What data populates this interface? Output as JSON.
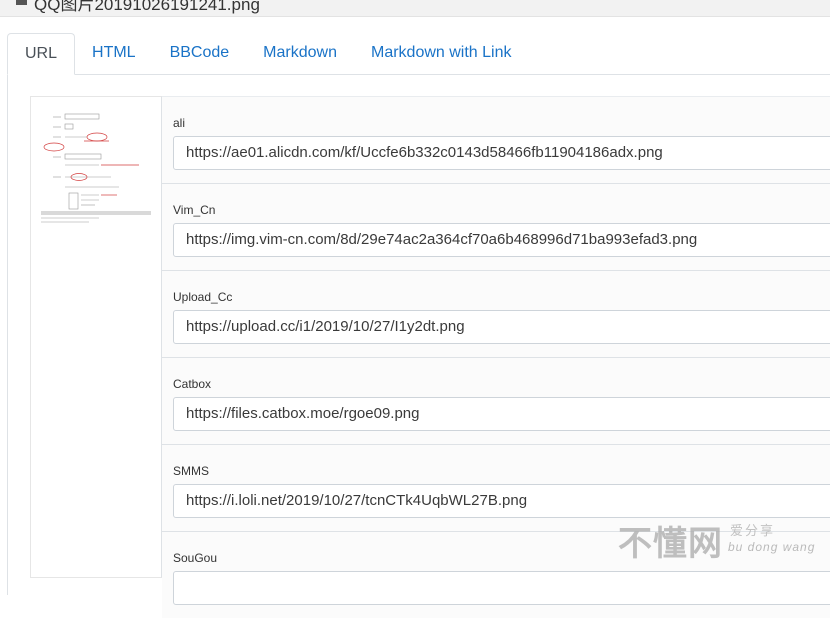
{
  "window": {
    "title": "QQ图片20191026191241.png"
  },
  "tabs": [
    {
      "label": "URL",
      "active": true
    },
    {
      "label": "HTML",
      "active": false
    },
    {
      "label": "BBCode",
      "active": false
    },
    {
      "label": "Markdown",
      "active": false
    },
    {
      "label": "Markdown with Link",
      "active": false
    }
  ],
  "links": [
    {
      "label": "ali",
      "url": "https://ae01.alicdn.com/kf/Uccfe6b332c0143d58466fb11904186adx.png"
    },
    {
      "label": "Vim_Cn",
      "url": "https://img.vim-cn.com/8d/29e74ac2a364cf70a6b468996d71ba993efad3.png"
    },
    {
      "label": "Upload_Cc",
      "url": "https://upload.cc/i1/2019/10/27/I1y2dt.png"
    },
    {
      "label": "Catbox",
      "url": "https://files.catbox.moe/rgoe09.png"
    },
    {
      "label": "SMMS",
      "url": "https://i.loli.net/2019/10/27/tcnCTk4UqbWL27B.png"
    },
    {
      "label": "SouGou",
      "url": ""
    }
  ],
  "watermark": {
    "main": "不懂网",
    "sub_cn": "爱分享",
    "sub_en": "bu dong wang"
  },
  "colors": {
    "link": "#1a73c7",
    "border": "#dee2e6",
    "field_border": "#ced4da"
  }
}
